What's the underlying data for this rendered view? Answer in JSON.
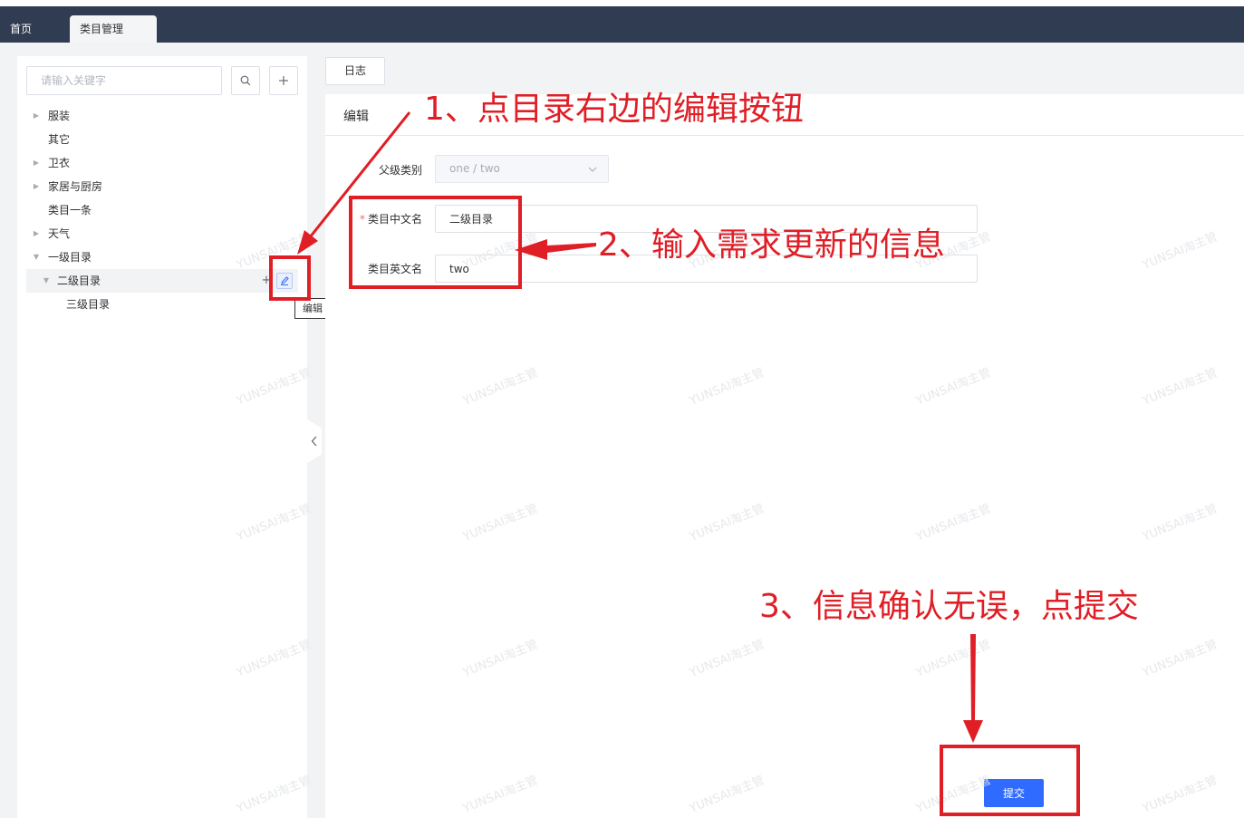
{
  "tabs": [
    {
      "label": "首页"
    },
    {
      "label": "类目管理"
    }
  ],
  "sidebar": {
    "search_placeholder": "请输入关键字",
    "search_icon": "search-icon",
    "add_icon": "plus-icon",
    "tree": [
      {
        "label": "服装",
        "has_children": true,
        "expanded": false
      },
      {
        "label": "其它",
        "has_children": false
      },
      {
        "label": "卫衣",
        "has_children": true,
        "expanded": false
      },
      {
        "label": "家居与厨房",
        "has_children": true,
        "expanded": false
      },
      {
        "label": "类目一条",
        "has_children": false
      },
      {
        "label": "天气",
        "has_children": true,
        "expanded": false
      },
      {
        "label": "一级目录",
        "has_children": true,
        "expanded": true
      },
      {
        "label": "二级目录",
        "has_children": true,
        "expanded": true,
        "selected": true
      },
      {
        "label": "三级目录",
        "has_children": false
      }
    ],
    "tooltip": "编辑"
  },
  "main": {
    "log_tab": "日志",
    "title": "编辑",
    "parent_label": "父级类别",
    "parent_value": "one / two",
    "cn_label": "类目中文名",
    "cn_value": "二级目录",
    "en_label": "类目英文名",
    "en_value": "two",
    "submit_label": "提交"
  },
  "watermark": "YUNSAI淘主管",
  "annotations": {
    "step1": "1、点目录右边的编辑按钮",
    "step2": "2、输入需求更新的信息",
    "step3": "3、信息确认无误，点提交",
    "color": "#e01e26"
  },
  "colors": {
    "tabbar": "#303c52",
    "primary": "#2f6bff",
    "annotation": "#e01e26"
  }
}
